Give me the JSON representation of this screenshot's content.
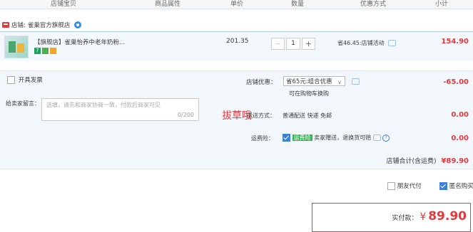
{
  "header": {
    "columns": [
      "店铺宝贝",
      "商品属性",
      "单价",
      "数量",
      "优惠方式",
      "小计"
    ]
  },
  "shop": {
    "prefix": "店铺:",
    "name": "雀巢官方旗舰店"
  },
  "item": {
    "title": "【旗舰店】雀巢怡养中老年奶粉...",
    "badge_7": "7",
    "unit_price": "201.35",
    "quantity": "1",
    "minus": "−",
    "plus": "+",
    "discount": "省46.45:店铺活动",
    "subtotal": "154.90"
  },
  "options": {
    "invoice_label": "开具发票",
    "shop_discount_label": "店铺优惠：",
    "shop_discount_value": "省65元:组合优惠",
    "shop_discount_hint": "可在购物车换购",
    "shop_discount_amount": "-65.00",
    "message_label": "给卖家留言：",
    "message_placeholder": "选填，请先和商家协商一致，付款后商家可见",
    "message_count": "0/200",
    "watermark": "拔草哦",
    "shipping_label": "运送方式：",
    "shipping_value": "普通配送 快递 免邮",
    "shipping_amount": "0.00",
    "insurance_label": "运费险：",
    "insurance_tag": "运费险",
    "insurance_value": "卖家赠送，退换货可赔",
    "insurance_amount": "0.00"
  },
  "shop_total": {
    "label": "店铺合计(含运费)",
    "value": "¥89.90"
  },
  "payment": {
    "friend_pay": "朋友代付",
    "anonymous": "匿名购买"
  },
  "final": {
    "label": "实付款：",
    "currency": "¥",
    "amount": "89.90"
  },
  "colors": {
    "accent_red": "#e4393c",
    "link_blue": "#3d82d8"
  }
}
